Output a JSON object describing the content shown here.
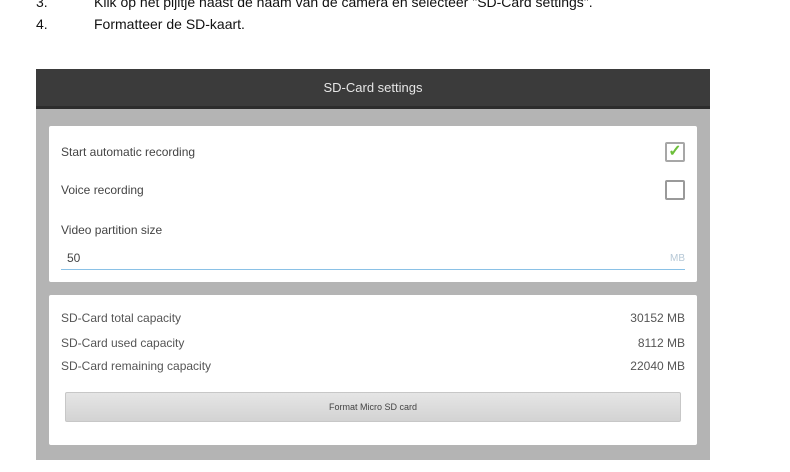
{
  "instructions": [
    {
      "num": "3.",
      "text": "Klik op het pijltje naast de naam van de camera en selecteer \"SD-Card settings\"."
    },
    {
      "num": "4.",
      "text": "Formatteer de SD-kaart."
    }
  ],
  "dialog": {
    "title": "SD-Card settings",
    "auto_recording": {
      "label": "Start automatic recording",
      "checked": true
    },
    "voice_recording": {
      "label": "Voice recording",
      "checked": false
    },
    "partition": {
      "label": "Video partition size",
      "value": "50",
      "unit": "MB"
    },
    "capacity": [
      {
        "label": "SD-Card total capacity",
        "value": "30152 MB"
      },
      {
        "label": "SD-Card used capacity",
        "value": "8112 MB"
      },
      {
        "label": "SD-Card remaining capacity",
        "value": "22040 MB"
      }
    ],
    "format_button": "Format Micro SD card"
  },
  "colors": {
    "titlebar": "#3b3b3b",
    "check": "#6cbf3a",
    "input_underline": "#8ac1e6"
  }
}
